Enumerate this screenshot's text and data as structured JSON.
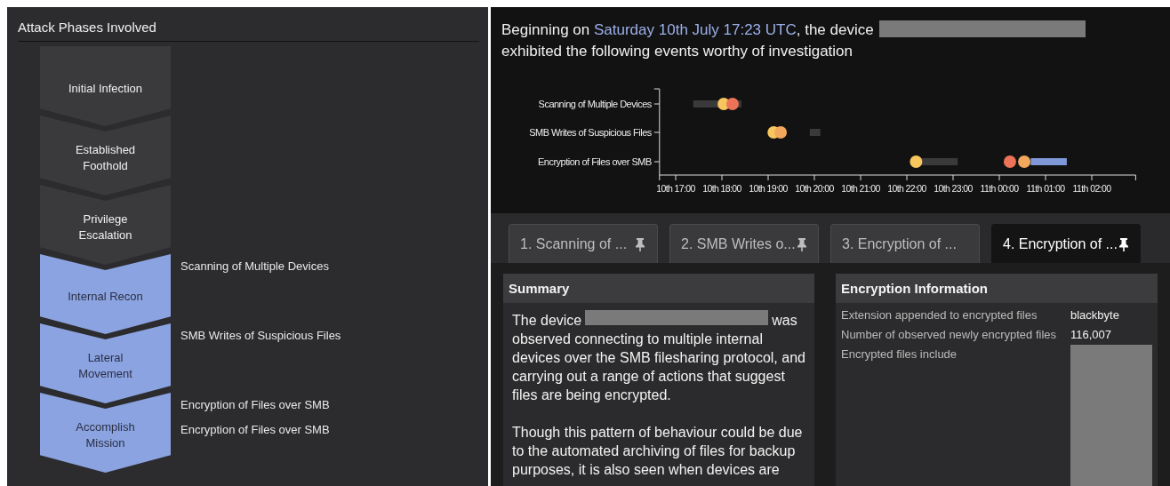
{
  "attack_phases": {
    "title": "Attack Phases Involved",
    "phases": [
      {
        "label": "Initial Infection",
        "active": false
      },
      {
        "label": "Established Foothold",
        "active": false
      },
      {
        "label": "Privilege Escalation",
        "active": false
      },
      {
        "label": "Internal Recon",
        "active": true,
        "events": [
          "Scanning of Multiple Devices"
        ]
      },
      {
        "label": "Lateral Movement",
        "active": true,
        "events": [
          "SMB Writes of Suspicious Files"
        ]
      },
      {
        "label": "Accomplish Mission",
        "active": true,
        "events": [
          "Encryption of Files over SMB",
          "Encryption of Files over SMB"
        ]
      }
    ]
  },
  "overview": {
    "intro_start": "Beginning on ",
    "intro_date": "Saturday 10th July 17:23 UTC",
    "intro_mid": ", the device",
    "intro_end": "exhibited the following events worthy of investigation",
    "timeline": {
      "row_labels": [
        "Scanning of Multiple Devices",
        "SMB Writes of Suspicious Files",
        "Encryption of Files over SMB"
      ],
      "tick_labels": [
        "10th 17:00",
        "10th 18:00",
        "10th 19:00",
        "10th 20:00",
        "10th 21:00",
        "10th 22:00",
        "10th 23:00",
        "11th 00:00",
        "11th 01:00",
        "11th 02:00"
      ]
    }
  },
  "tabs": [
    {
      "label": "1. Scanning of ...",
      "pinned": true,
      "selected": false
    },
    {
      "label": "2. SMB Writes o...",
      "pinned": true,
      "selected": false
    },
    {
      "label": "3. Encryption of ...",
      "pinned": false,
      "selected": false
    },
    {
      "label": "4. Encryption of ...",
      "pinned": true,
      "selected": true
    }
  ],
  "summary": {
    "title": "Summary",
    "text_before": "The device",
    "text_after": "was",
    "text_rest": "observed connecting to multiple internal devices over the SMB filesharing protocol, and carrying out a range of actions that suggest files are being encrypted.",
    "paragraph_2": "Though this pattern of behaviour could be due to the automated archiving of files for backup purposes, it is also seen when devices are"
  },
  "encryption_information": {
    "title": "Encryption Information",
    "rows": [
      {
        "label": "Extension appended to encrypted files",
        "value": "blackbyte",
        "kind": "text"
      },
      {
        "label": "Number of observed newly encrypted files",
        "value": "116,007",
        "kind": "text"
      },
      {
        "label": "Encrypted files include",
        "kind": "redacted"
      }
    ]
  }
}
